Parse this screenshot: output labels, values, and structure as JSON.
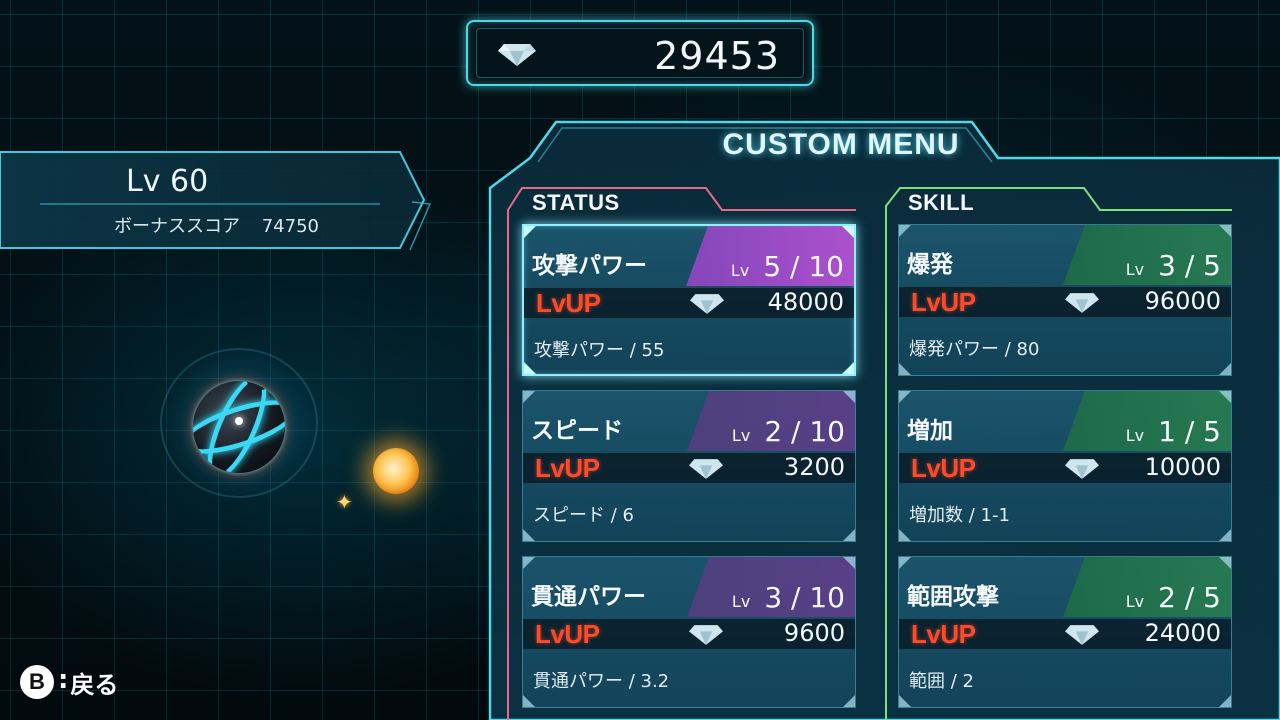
{
  "currency": {
    "icon": "diamond-icon",
    "amount": "29453"
  },
  "player": {
    "level": "Lv 60",
    "bonus_label": "ボーナススコア",
    "bonus_value": "74750"
  },
  "menu": {
    "title": "CUSTOM MENU"
  },
  "status": {
    "header": "STATUS",
    "cards": [
      {
        "name": "攻撃パワー",
        "lv_tag": "Lv",
        "level": "5 / 10",
        "lvup": "LvUP",
        "cost": "48000",
        "desc": "攻撃パワー / 55"
      },
      {
        "name": "スピード",
        "lv_tag": "Lv",
        "level": "2 / 10",
        "lvup": "LvUP",
        "cost": "3200",
        "desc": "スピード / 6"
      },
      {
        "name": "貫通パワー",
        "lv_tag": "Lv",
        "level": "3 / 10",
        "lvup": "LvUP",
        "cost": "9600",
        "desc": "貫通パワー / 3.2"
      }
    ]
  },
  "skill": {
    "header": "SKILL",
    "cards": [
      {
        "name": "爆発",
        "lv_tag": "Lv",
        "level": "3 / 5",
        "lvup": "LvUP",
        "cost": "96000",
        "desc": "爆発パワー / 80"
      },
      {
        "name": "増加",
        "lv_tag": "Lv",
        "level": "1 / 5",
        "lvup": "LvUP",
        "cost": "10000",
        "desc": "増加数 / 1-1"
      },
      {
        "name": "範囲攻撃",
        "lv_tag": "Lv",
        "level": "2 / 5",
        "lvup": "LvUP",
        "cost": "24000",
        "desc": "範囲 / 2"
      }
    ]
  },
  "controls": {
    "back_key": "B",
    "back_label": "戻る"
  },
  "colors": {
    "accent": "#4fd8e8",
    "status_frame": "#e36a8a",
    "skill_frame": "#7ee07a",
    "lvup": "#ff4a2a"
  }
}
